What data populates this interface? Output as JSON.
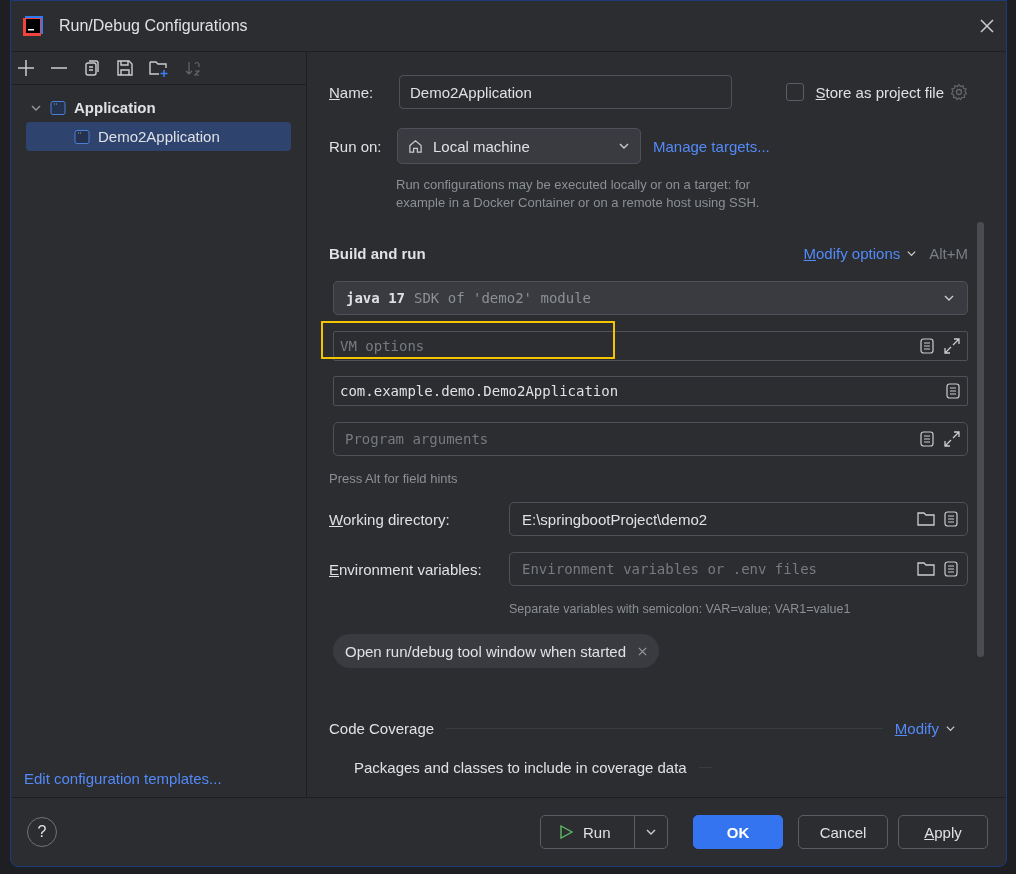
{
  "window": {
    "title": "Run/Debug Configurations"
  },
  "tree": [
    {
      "label": "Application",
      "expanded": true,
      "selected": false,
      "children": [
        {
          "label": "Demo2Application",
          "selected": true
        }
      ]
    }
  ],
  "sidebar_link": "Edit configuration templates...",
  "name": {
    "label": "Name:",
    "value": "Demo2Application"
  },
  "store_as_project_file": {
    "label": "Store as project file",
    "checked": false
  },
  "run_on": {
    "label": "Run on:",
    "value": "Local machine",
    "link": "Manage targets...",
    "hint": "Run configurations may be executed locally or on a target: for example in a Docker Container or on a remote host using SSH."
  },
  "build_and_run": {
    "title": "Build and run",
    "modify": "Modify options",
    "shortcut": "Alt+M",
    "sdk": {
      "value": "java 17",
      "detail": "SDK of 'demo2' module"
    },
    "vm_options": {
      "placeholder": "VM options",
      "highlighted": true
    },
    "main_class": {
      "value": "com.example.demo.Demo2Application"
    },
    "program_arguments": {
      "placeholder": "Program arguments"
    },
    "field_hint": "Press Alt for field hints"
  },
  "working_directory": {
    "label": "Working directory:",
    "value": "E:\\springbootProject\\demo2"
  },
  "environment_variables": {
    "label": "Environment variables:",
    "placeholder": "Environment variables or .env files",
    "hint": "Separate variables with semicolon: VAR=value; VAR1=value1"
  },
  "tags": [
    {
      "label": "Open run/debug tool window when started"
    }
  ],
  "code_coverage": {
    "title": "Code Coverage",
    "modify": "Modify",
    "subsection": "Packages and classes to include in coverage data"
  },
  "help": "?",
  "buttons": [
    {
      "label": "Run",
      "kind": "split"
    },
    {
      "label": "OK",
      "kind": "primary"
    },
    {
      "label": "Cancel",
      "kind": "normal"
    },
    {
      "label": "Apply",
      "kind": "normal"
    }
  ]
}
